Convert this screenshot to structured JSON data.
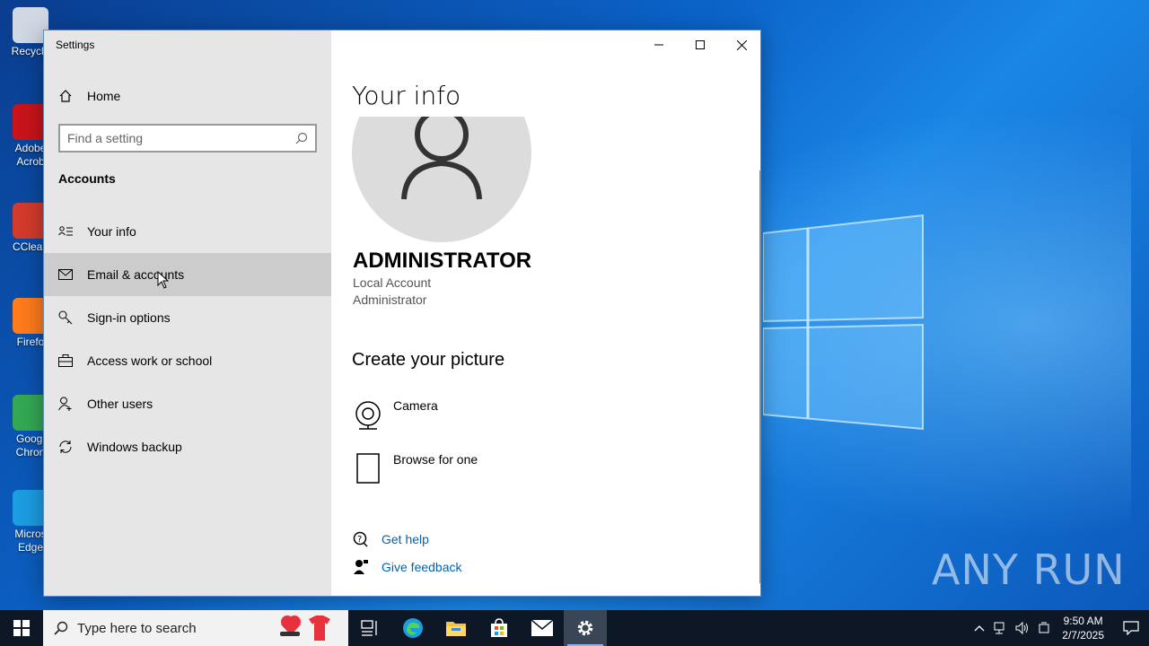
{
  "desktop": {
    "icons": [
      {
        "label": "Recycle",
        "color": "#cfd8e3"
      },
      {
        "label": "Adobe\nAcrob",
        "color": "#c8141a"
      },
      {
        "label": "CClean",
        "color": "#d33b2c"
      },
      {
        "label": "Firefo",
        "color": "#ff7b1c"
      },
      {
        "label": "Googl\nChron",
        "color": "#34a853"
      },
      {
        "label": "Micros\nEdge",
        "color": "#1b9de2"
      }
    ],
    "watermark": "ANY RUN"
  },
  "window": {
    "title": "Settings",
    "controls": {
      "minimize": "—",
      "maximize": "☐",
      "close": "✕"
    }
  },
  "sidebar": {
    "home_label": "Home",
    "search_placeholder": "Find a setting",
    "section_heading": "Accounts",
    "items": [
      {
        "label": "Your info",
        "icon": "contact-card-icon",
        "active": false
      },
      {
        "label": "Email & accounts",
        "icon": "mail-icon",
        "active": true
      },
      {
        "label": "Sign-in options",
        "icon": "key-icon",
        "active": false
      },
      {
        "label": "Access work or school",
        "icon": "briefcase-icon",
        "active": false
      },
      {
        "label": "Other users",
        "icon": "person-add-icon",
        "active": false
      },
      {
        "label": "Windows backup",
        "icon": "sync-icon",
        "active": false
      }
    ]
  },
  "main": {
    "title": "Your info",
    "user_name": "ADMINISTRATOR",
    "account_type": "Local Account",
    "account_role": "Administrator",
    "create_heading": "Create your picture",
    "camera_label": "Camera",
    "browse_label": "Browse for one",
    "get_help": "Get help",
    "give_feedback": "Give feedback"
  },
  "taskbar": {
    "search_placeholder": "Type here to search",
    "time": "9:50 AM",
    "date": "2/7/2025"
  }
}
